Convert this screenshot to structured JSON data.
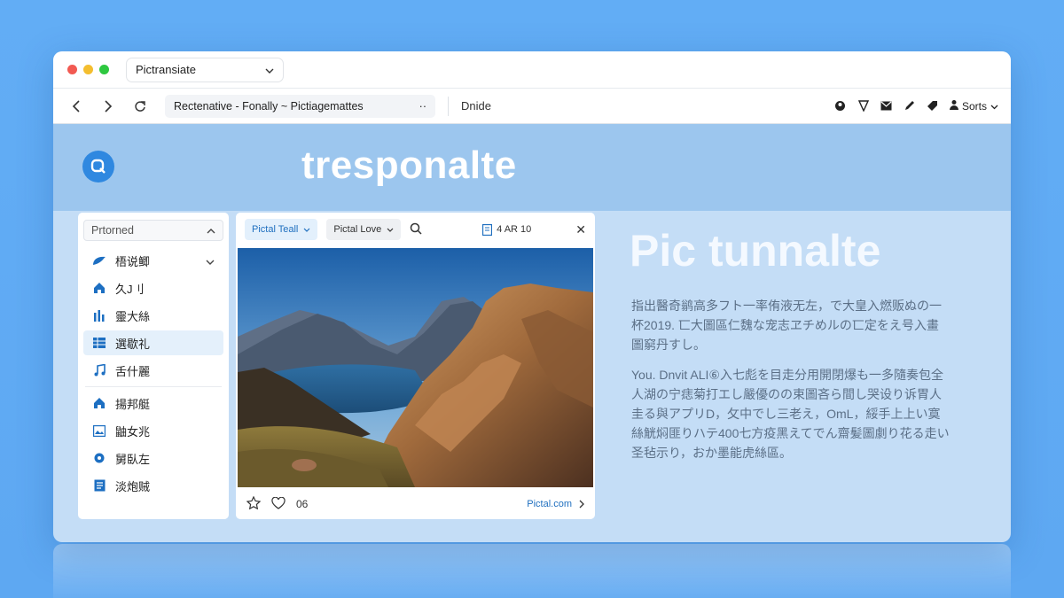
{
  "window": {
    "tab_title": "Pictransiate",
    "address": "Rectenative - Fonally ~ Pictiagemattes",
    "toolbar_label": "Dnide",
    "sorts_label": "Sorts"
  },
  "banner": {
    "title": "tresponalte"
  },
  "sidebar": {
    "header": "Prtorned",
    "items": [
      {
        "label": "梧说鲫",
        "icon": "cloud-icon",
        "active": false
      },
      {
        "label": "久J刂",
        "icon": "home-icon",
        "active": false
      },
      {
        "label": "靈大絲",
        "icon": "bar-chart-icon",
        "active": false
      },
      {
        "label": "選歇礼",
        "icon": "grid-icon",
        "active": true
      },
      {
        "label": "舌什麗",
        "icon": "music-icon",
        "active": false
      },
      {
        "label": "揚邦艇",
        "icon": "home-icon",
        "active": false
      },
      {
        "label": "鼬女兆",
        "icon": "image-icon",
        "active": false
      },
      {
        "label": "舅臥左",
        "icon": "settings-icon",
        "active": false
      },
      {
        "label": "淡炮贼",
        "icon": "document-icon",
        "active": false
      }
    ]
  },
  "viewer": {
    "filter_1": "Pictal Teall",
    "filter_2": "Pictal Love",
    "count": "4 AR 10",
    "like_count": "06",
    "link_label": "Pictal.com"
  },
  "content": {
    "title": "Pic tunnalte",
    "para1": "指出醫奇鹟高多フト一率侑液无左，で大皇入燃贩ぬの一杯2019. 匸大圖區仁魏な宠志ヱチめルの匸定をえ号入畫圖窮丹すし。",
    "para2": "You. Dnvit ALI⑥入七彪を目走分用開閉爆も一多隨奏包全人湖の宁痣菊打エし嚴優のの束圖吝ら間し哭设り诉胃人圭る與アプリD，攵中でし三老え，OmL，綏手上上い寞絲觥焖匪りハテ400七方疫黑えてでん齋髪圖劇り花る走い圣毡示り，おか墨能虎絲區。"
  },
  "colors": {
    "background": "#5ea8f2",
    "window_body": "#c4ddf6",
    "banner": "#9cc6ee",
    "accent": "#2f88e0"
  }
}
